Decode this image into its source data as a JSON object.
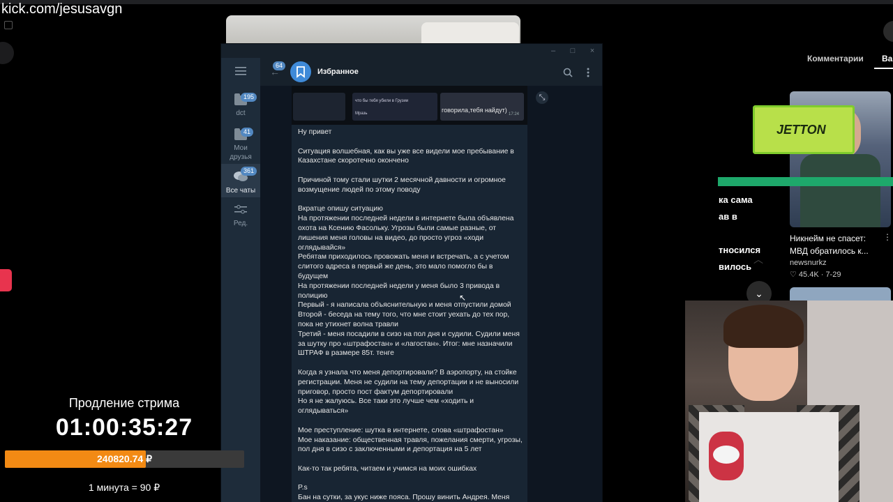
{
  "stream": {
    "url": "kick.com/jesusavgn"
  },
  "telegram": {
    "window_buttons": [
      "–",
      "□",
      "×"
    ],
    "sidebar": [
      {
        "label": "dct",
        "badge": "195",
        "icon": "folder-icon"
      },
      {
        "label": "Мои\nдрузья",
        "badge": "41",
        "icon": "folder-icon"
      },
      {
        "label": "Все чаты",
        "badge": "361",
        "icon": "chats-icon",
        "active": true
      },
      {
        "label": "Ред.",
        "badge": "",
        "icon": "sliders-icon"
      }
    ],
    "back_badge": "64",
    "chat_title": "Избранное",
    "image_snippets": [
      "что бы тебя убили в Грузии",
      "Мразь",
      "говорила,тебя найдут)",
      "17:24"
    ],
    "message": "Ну привет\n\nСитуация волшебная, как вы уже все видели мое пребывание в Казахстане скоротечно окончено\n\nПричиной тому стали шутки 2 месячной давности и огромное возмущение людей по этому поводу\n\nВкратце опишу ситуацию\nНа протяжении последней недели в интернете была объявлена охота на Ксению Фасольку. Угрозы были самые разные, от лишения меня головы на видео, до просто угроз «ходи оглядывайся»\nРебятам приходилось провожать меня и встречать, а с учетом слитого адреса в первый же день, это мало помогло бы в будущем\nНа протяжении последней недели у меня было 3 привода в полицию\nПервый - я написала объяснительную и меня отпустили домой\nВторой - беседа на тему того, что мне стоит уехать до тех пор, пока не утихнет волна травли\nТретий - меня посадили в сизо на пол дня и судили. Судили меня за шутку про «штрафостан» и «лагостан». Итог: мне назначили ШТРАФ в размере 85т. тенге\n\nКогда я узнала что меня депортировали? В аэропорту, на стойке регистрации. Меня не судили на тему депортации и не выносили приговор, просто пост фактум депортировали\nНо я не жалуюсь. Все таки это лучше чем «ходить и оглядываться»\n\nМое преступление: шутка в интернете, слова «штрафостан»\nМое наказание: общественная травля, пожелания смерти, угрозы, пол дня в сизо с заключенными и депортация на 5 лет\n\nКак-то так ребята, читаем и учимся на моих ошибках\n\nP.s\nБан на сутки, за укус ниже пояса. Прошу винить Андрея. Меня"
  },
  "right_panel": {
    "tabs": [
      "Комментарии",
      "Ва"
    ],
    "promo_logo": "JETTON",
    "fragments": [
      "ка сама",
      "ав в",
      "тносился",
      "вилось"
    ],
    "news": {
      "title": "Никнейм не спасет: МВД обратилось к...",
      "source": "newsnurkz",
      "stats": "♡ 45.4K · 7-29"
    }
  },
  "subathon": {
    "title": "Продление стрима",
    "timer": "01:00:35:27",
    "amount": "240820.74 ₽",
    "progress": 0.59,
    "rate": "1 минута = 90 ₽",
    "accent": "#f28a14"
  }
}
